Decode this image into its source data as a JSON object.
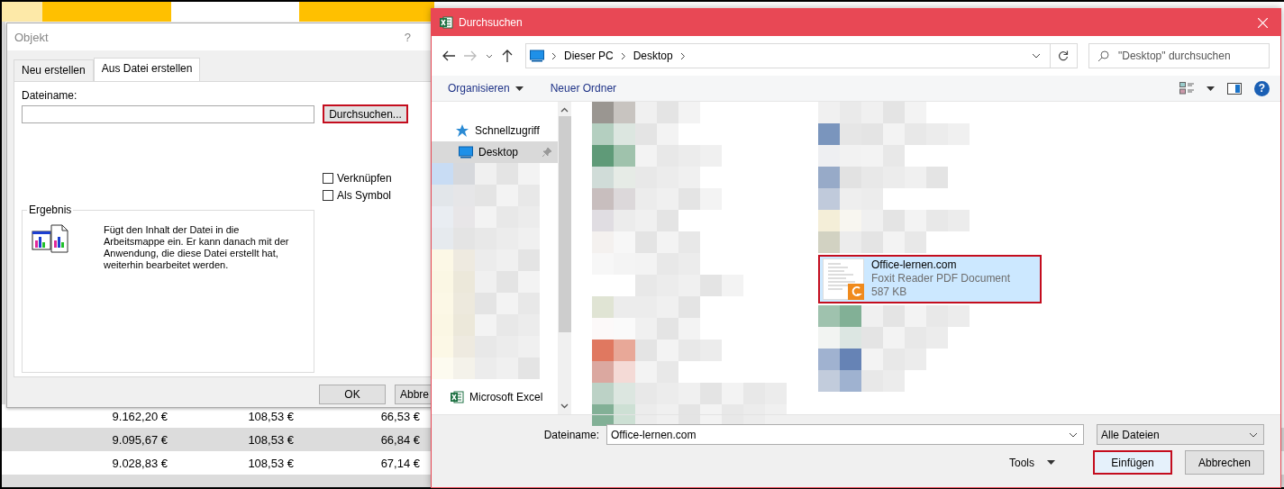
{
  "spreadsheet": {
    "rows": [
      {
        "shaded": false,
        "cells": [
          "9.162,20 €",
          "108,53 €",
          "66,53 €"
        ]
      },
      {
        "shaded": true,
        "cells": [
          "9.095,67 €",
          "108,53 €",
          "66,84 €"
        ]
      },
      {
        "shaded": false,
        "cells": [
          "9.028,83 €",
          "108,53 €",
          "67,14 €"
        ]
      }
    ]
  },
  "object_dialog": {
    "title": "Objekt",
    "help": "?",
    "tabs": [
      {
        "label": "Neu erstellen",
        "selected": false
      },
      {
        "label": "Aus Datei erstellen",
        "selected": true
      }
    ],
    "filename_label": "Dateiname:",
    "browse_button": {
      "label": "Durchsuchen...",
      "highlighted": true
    },
    "checkboxes": [
      {
        "label": "Verknüpfen",
        "checked": false
      },
      {
        "label": "Als Symbol",
        "checked": false
      }
    ],
    "result": {
      "title": "Ergebnis",
      "text": "Fügt den Inhalt der Datei in die Arbeitsmappe ein. Er kann danach mit der Anwendung, die diese Datei erstellt hat, weiterhin bearbeitet werden."
    },
    "buttons": [
      {
        "label": "OK"
      },
      {
        "label": "Abbre"
      }
    ]
  },
  "browse_dialog": {
    "title": "Durchsuchen",
    "breadcrumb": [
      "Dieser PC",
      "Desktop"
    ],
    "search": {
      "placeholder": "\"Desktop\" durchsuchen"
    },
    "toolbar": [
      {
        "label": "Organisieren",
        "kind": "menu"
      },
      {
        "label": "Neuer Ordner",
        "kind": "button"
      }
    ],
    "help": "?",
    "nav_items": [
      {
        "label": "Schnellzugriff",
        "kind": "quick",
        "selected": false
      },
      {
        "label": "Desktop",
        "kind": "desktop",
        "selected": true
      },
      {
        "label": "Microsoft Excel",
        "kind": "excel",
        "selected": false
      }
    ],
    "file": {
      "name": "Office-lernen.com",
      "type": "Foxit Reader PDF Document",
      "size": "587 KB",
      "selected": true,
      "highlighted": true
    },
    "filename_label": "Dateiname:",
    "filename_value": "Office-lernen.com",
    "filter": "Alle Dateien",
    "tools": "Tools",
    "buttons": [
      {
        "label": "Einfügen",
        "highlighted": true
      },
      {
        "label": "Abbrechen",
        "highlighted": false
      }
    ]
  }
}
